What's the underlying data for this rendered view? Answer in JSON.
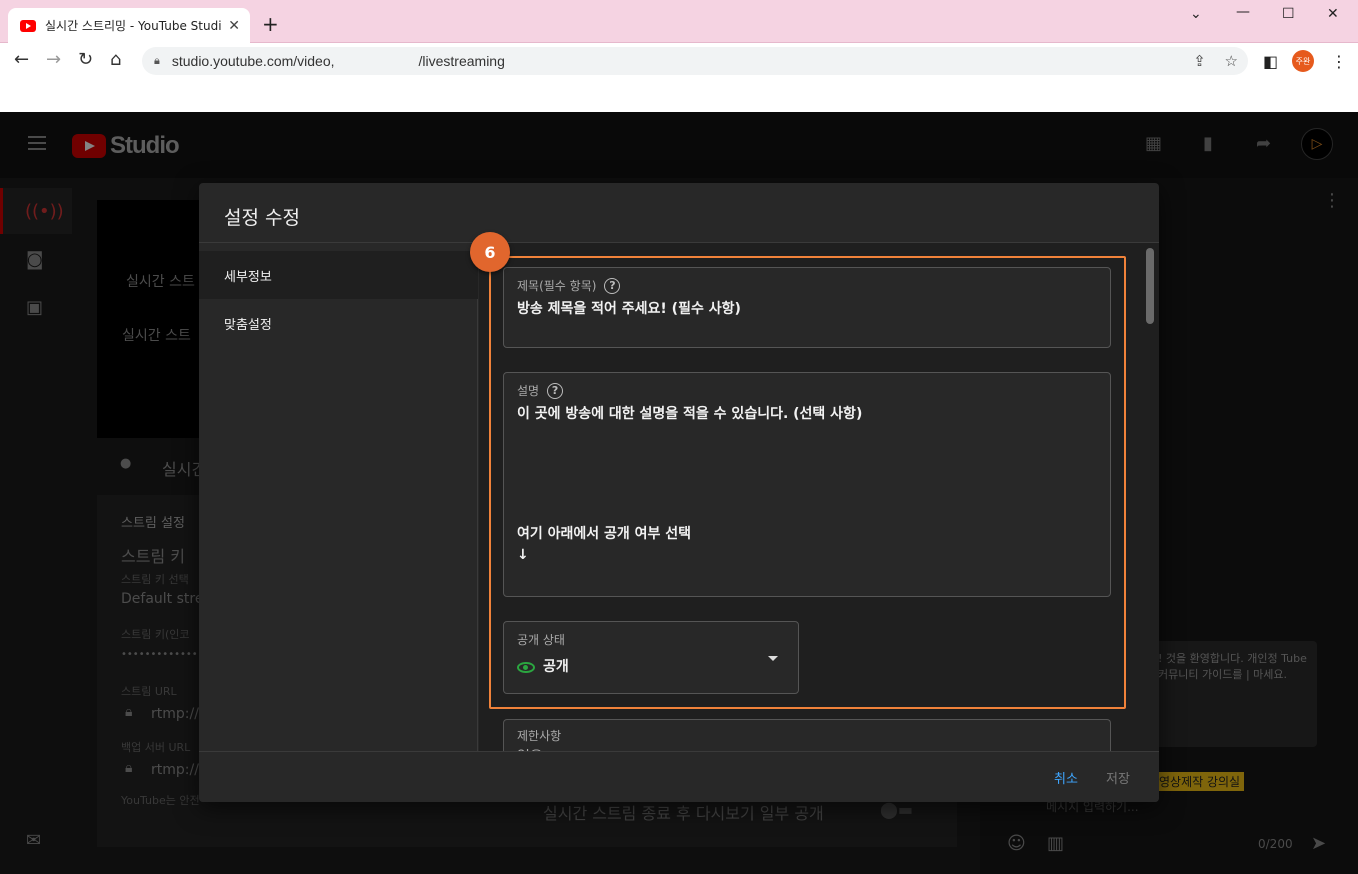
{
  "browser": {
    "tab_title": "실시간 스트리밍 - YouTube Studio",
    "url_prefix": "studio.youtube.com/video,",
    "url_suffix": "/livestreaming",
    "profile_label": "주완"
  },
  "studio": {
    "logo_text": "Studio",
    "bg": {
      "t1": "실시간 스트",
      "t2": "실시간 스트",
      "t3": "실시긴",
      "t4": "스트림 설정",
      "t5": "스트림 키",
      "t6": "스트림 키 선택",
      "t7": "Default stre",
      "t8": "스트림 키(인코",
      "t9": "••••••••••••••••••",
      "t10": "스트림 URL",
      "t11": "rtmp://",
      "t12": "백업 서버 URL",
      "t13": "rtmp://",
      "t14": "YouTube는 안전",
      "t15": "실시간 스트림 종료 후 다시보기 일부 공개"
    },
    "chat": {
      "notice": "! 것을 환영합니다. 개인정 Tube 커뮤니티 가이드를 | 마세요.",
      "badge": "영상제작 강의실",
      "input_placeholder": "메시지 입력하기...",
      "count": "0/200"
    }
  },
  "modal": {
    "title": "설정 수정",
    "nav": [
      "세부정보",
      "맞춤설정"
    ],
    "step_badge": "6",
    "title_field": {
      "label": "제목(필수 항목)",
      "value": "방송 제목을 적어 주세요! (필수 사항)"
    },
    "desc_field": {
      "label": "설명",
      "line1": "이 곳에 방송에 대한 설명을 적을 수 있습니다. (선택 사항)",
      "line2": "여기 아래에서 공개 여부 선택",
      "line3": "↓"
    },
    "visibility": {
      "label": "공개 상태",
      "value": "공개"
    },
    "restrictions": {
      "label": "제한사항",
      "value": "없음"
    },
    "cancel_label": "취소",
    "save_label": "저장"
  }
}
